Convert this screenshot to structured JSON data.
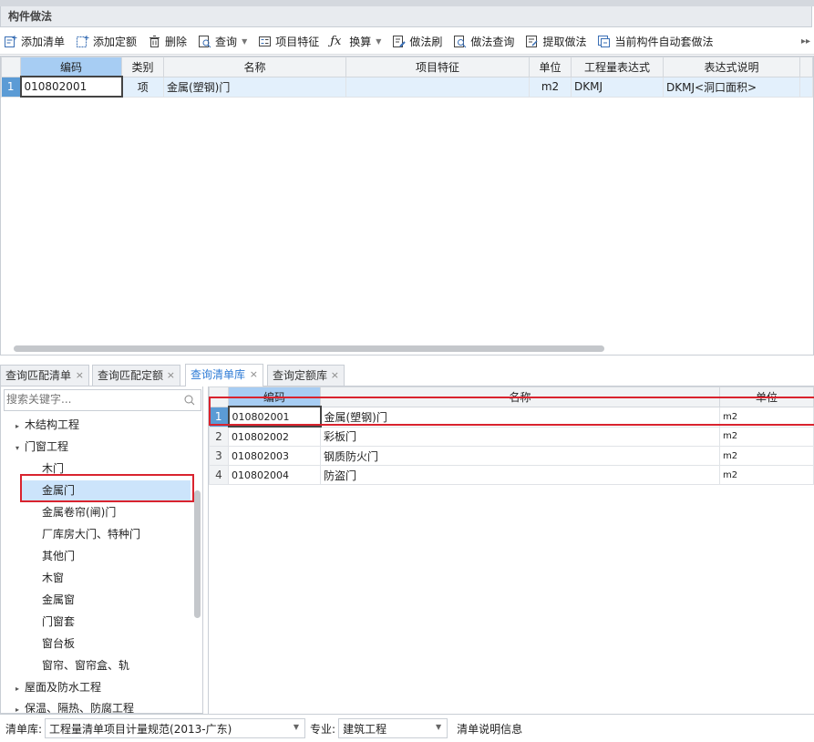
{
  "panel_title": "构件做法",
  "toolbar": {
    "add_list": "添加清单",
    "add_quota": "添加定额",
    "delete": "删除",
    "query": "查询",
    "project_feature": "项目特征",
    "convert": "换算",
    "method_brush": "做法刷",
    "method_query": "做法查询",
    "extract_method": "提取做法",
    "auto_apply": "当前构件自动套做法"
  },
  "top_grid": {
    "headers": [
      "编码",
      "类别",
      "名称",
      "项目特征",
      "单位",
      "工程量表达式",
      "表达式说明"
    ],
    "rows": [
      {
        "num": "1",
        "code": "010802001",
        "type": "项",
        "name": "金属(塑钢)门",
        "feature": "",
        "unit": "m2",
        "expr": "DKMJ",
        "expr_desc": "DKMJ<洞口面积>"
      }
    ]
  },
  "tabs": [
    {
      "label": "查询匹配清单"
    },
    {
      "label": "查询匹配定额"
    },
    {
      "label": "查询清单库"
    },
    {
      "label": "查询定额库"
    }
  ],
  "search": {
    "placeholder": "搜索关键字..."
  },
  "tree": [
    {
      "label": "木结构工程"
    },
    {
      "label": "门窗工程"
    },
    {
      "label": "木门"
    },
    {
      "label": "金属门"
    },
    {
      "label": "金属卷帘(闸)门"
    },
    {
      "label": "厂库房大门、特种门"
    },
    {
      "label": "其他门"
    },
    {
      "label": "木窗"
    },
    {
      "label": "金属窗"
    },
    {
      "label": "门窗套"
    },
    {
      "label": "窗台板"
    },
    {
      "label": "窗帘、窗帘盒、轨"
    },
    {
      "label": "屋面及防水工程"
    },
    {
      "label": "保温、隔热、防腐工程"
    }
  ],
  "lib_grid": {
    "headers": [
      "编码",
      "名称",
      "单位"
    ],
    "rows": [
      {
        "num": "1",
        "code": "010802001",
        "name": "金属(塑钢)门",
        "unit": "m2"
      },
      {
        "num": "2",
        "code": "010802002",
        "name": "彩板门",
        "unit": "m2"
      },
      {
        "num": "3",
        "code": "010802003",
        "name": "钢质防火门",
        "unit": "m2"
      },
      {
        "num": "4",
        "code": "010802004",
        "name": "防盗门",
        "unit": "m2"
      }
    ]
  },
  "footer": {
    "lib_label": "清单库:",
    "lib_value": "工程量清单项目计量规范(2013-广东)",
    "spec_label": "专业:",
    "spec_value": "建筑工程",
    "info": "清单说明信息"
  },
  "colors": {
    "accent": "#2e7bd6",
    "highlight": "#d9232e",
    "header_selected": "#a7cdf3"
  }
}
